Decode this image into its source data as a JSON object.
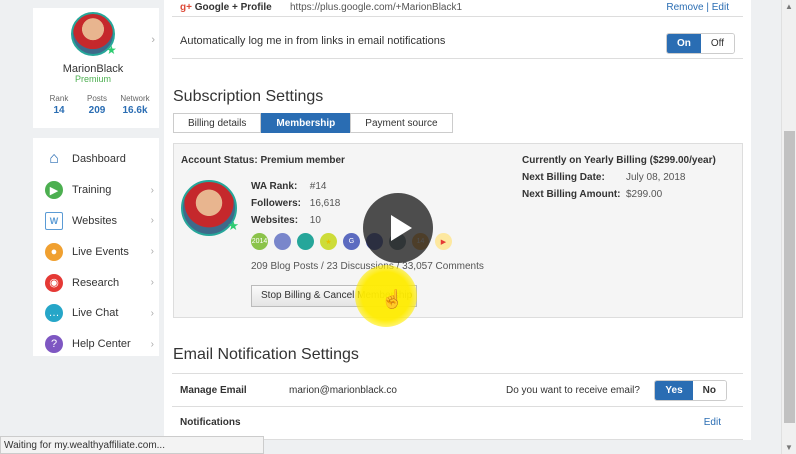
{
  "sidebar": {
    "profile": {
      "name": "MarionBlack",
      "tier": "Premium",
      "stats": [
        {
          "label": "Rank",
          "value": "14"
        },
        {
          "label": "Posts",
          "value": "209"
        },
        {
          "label": "Network",
          "value": "16.6k"
        }
      ]
    },
    "menu": [
      {
        "label": "Dashboard",
        "icon": "home-icon",
        "color": "#2a6db3"
      },
      {
        "label": "Training",
        "icon": "play-circle-icon",
        "color": "#4caf50"
      },
      {
        "label": "Websites",
        "icon": "websites-icon",
        "color": "#5b9bd5"
      },
      {
        "label": "Live Events",
        "icon": "live-events-icon",
        "color": "#f0a030"
      },
      {
        "label": "Research",
        "icon": "research-icon",
        "color": "#e53935"
      },
      {
        "label": "Live Chat",
        "icon": "chat-icon",
        "color": "#26a6c8"
      },
      {
        "label": "Help Center",
        "icon": "help-icon",
        "color": "#7e57c2"
      }
    ]
  },
  "main": {
    "google": {
      "label": "Google + Profile",
      "url": "https://plus.google.com/+MarionBlack1",
      "remove": "Remove",
      "sep": "|",
      "edit": "Edit"
    },
    "auto_login": {
      "text": "Automatically log me in from links in email notifications",
      "on": "On",
      "off": "Off",
      "selected": "On"
    },
    "subscription": {
      "title": "Subscription Settings",
      "tabs": [
        "Billing details",
        "Membership",
        "Payment source"
      ],
      "active_tab": "Membership",
      "account_status": "Account Status: Premium member",
      "wa_rank_label": "WA Rank:",
      "wa_rank": "#14",
      "followers_label": "Followers:",
      "followers": "16,618",
      "websites_label": "Websites:",
      "websites": "10",
      "badges": [
        {
          "icon": "badge-2014-icon",
          "text": "2014",
          "color": "#8bc34a"
        },
        {
          "icon": "badge-person-icon",
          "text": "",
          "color": "#7986cb"
        },
        {
          "icon": "badge-list-icon",
          "text": "",
          "color": "#26a69a"
        },
        {
          "icon": "badge-star-icon",
          "text": "★",
          "color": "#cddc39"
        },
        {
          "icon": "badge-g-icon",
          "text": "G",
          "color": "#5c6bc0"
        },
        {
          "icon": "badge-circle-icon",
          "text": "",
          "color": "#3949ab"
        },
        {
          "icon": "badge-dark-icon",
          "text": "",
          "color": "#546e7a"
        },
        {
          "icon": "badge-14-icon",
          "text": "14",
          "color": "#f0a030"
        },
        {
          "icon": "badge-flag-icon",
          "text": "▶",
          "color": "#e53935"
        }
      ],
      "counts": "209 Blog Posts / 23 Discussions / 33,057 Comments",
      "stop_button": "Stop Billing & Cancel Membership",
      "billing_title": "Currently on Yearly Billing ($299.00/year)",
      "next_date_label": "Next Billing Date:",
      "next_date": "July 08, 2018",
      "next_amount_label": "Next Billing Amount:",
      "next_amount": "$299.00"
    },
    "email": {
      "title": "Email Notification Settings",
      "manage_label": "Manage Email",
      "address": "marion@marionblack.co",
      "question": "Do you want to receive email?",
      "yes": "Yes",
      "no": "No",
      "selected": "Yes",
      "notifications_label": "Notifications",
      "notifications_edit": "Edit"
    }
  },
  "statusbar": {
    "text": "Waiting for my.wealthyaffiliate.com..."
  }
}
